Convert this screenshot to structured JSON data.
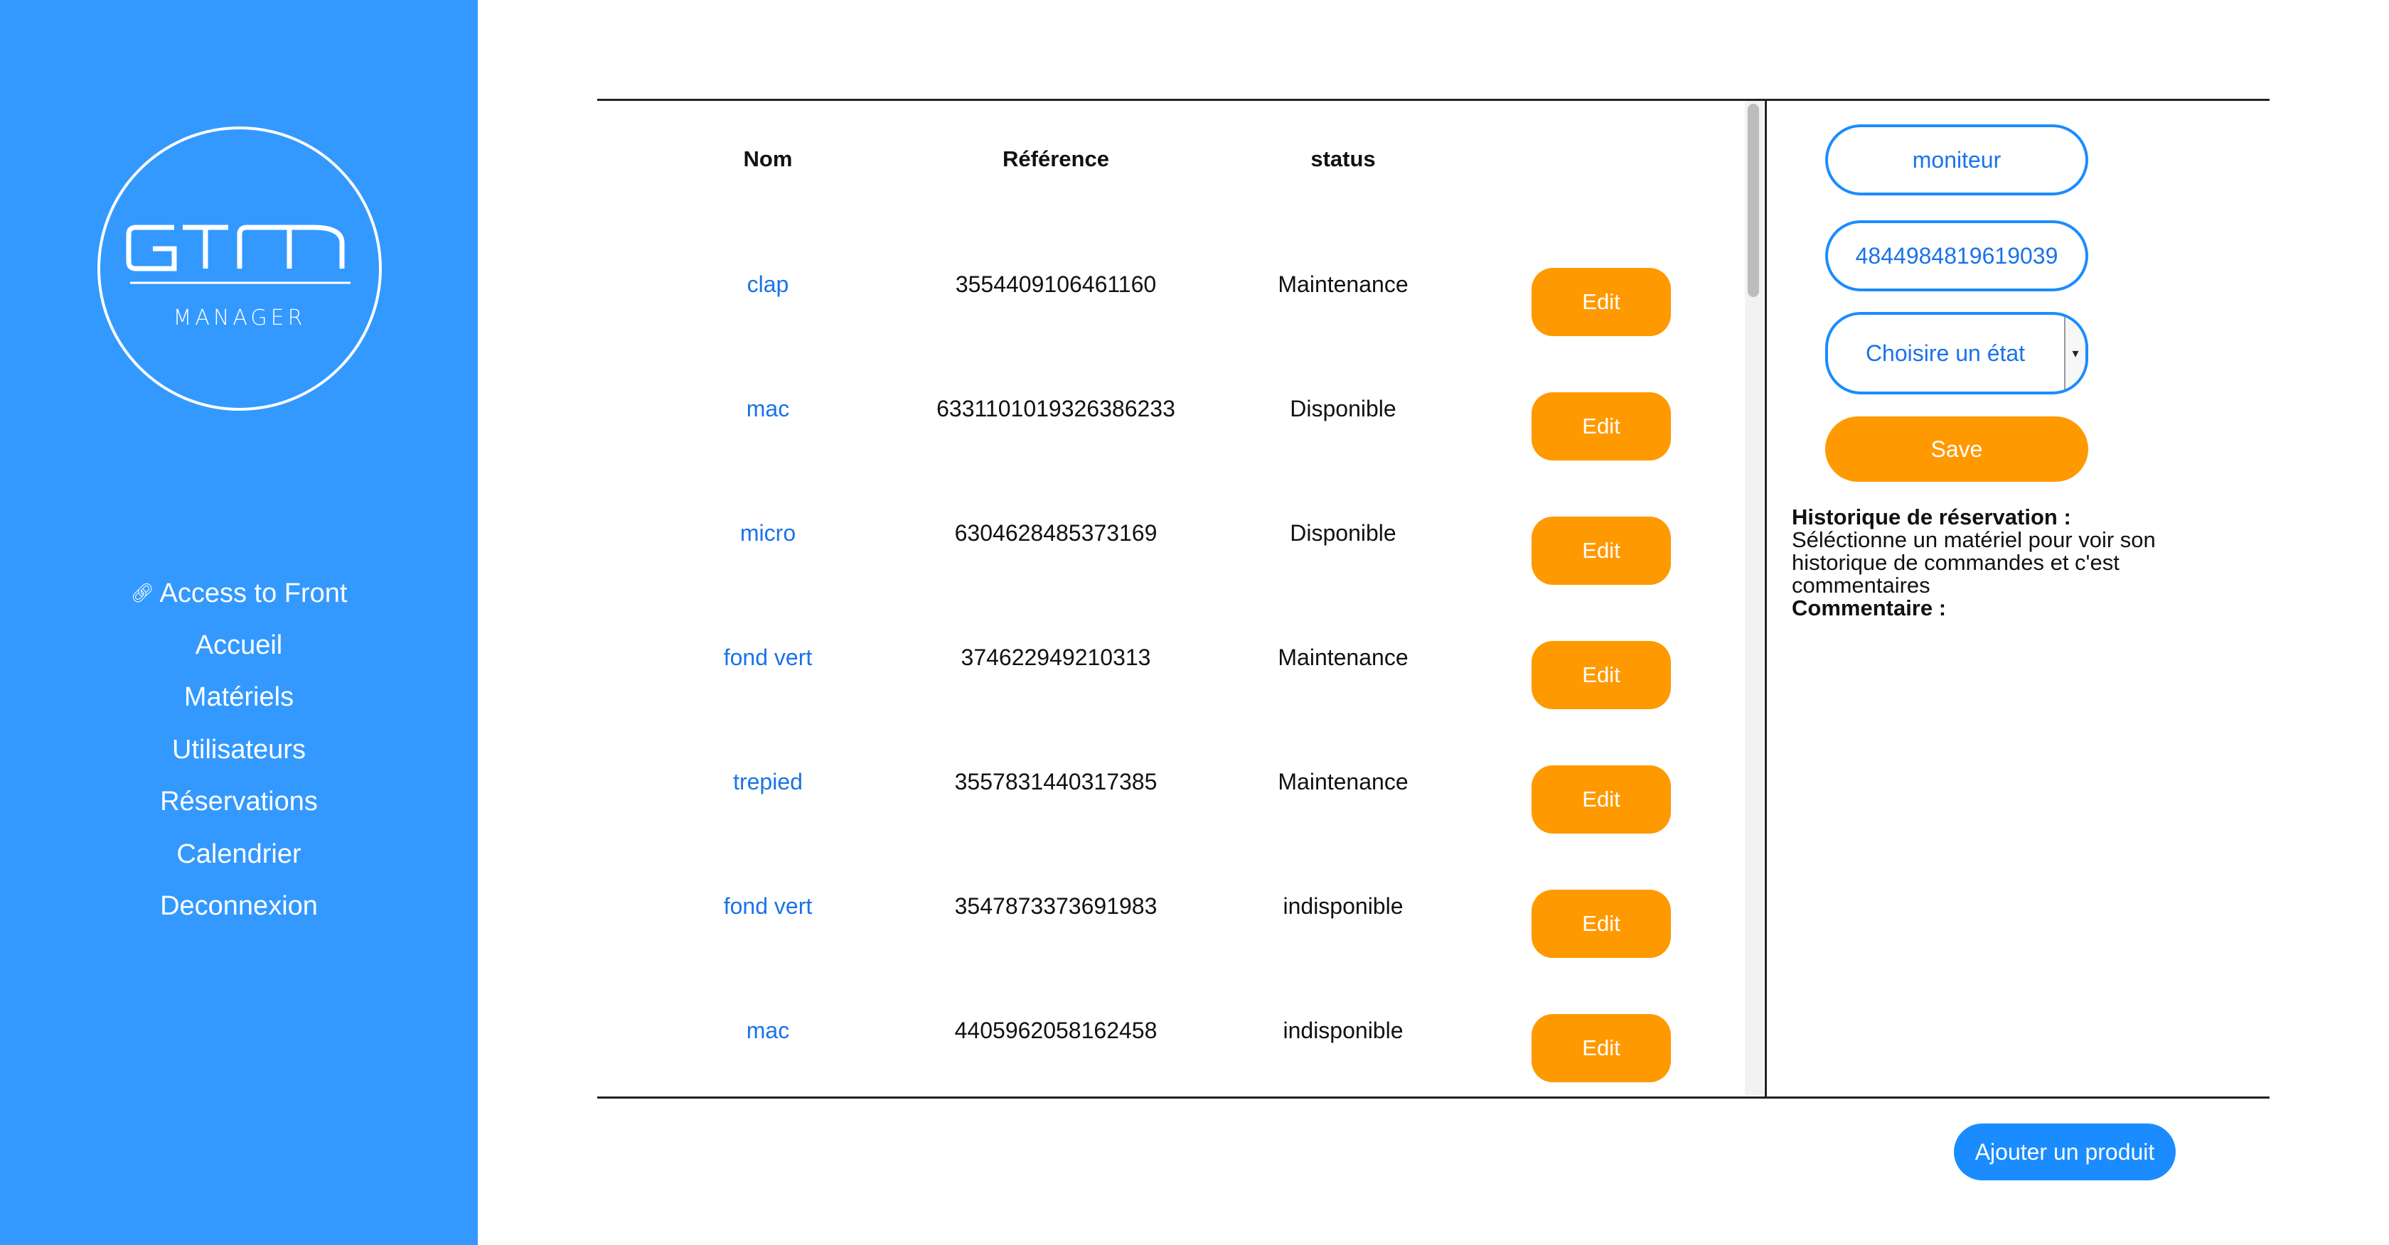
{
  "brand": {
    "logo_main": "GTM",
    "logo_sub": "MANAGER"
  },
  "sidebar": {
    "items": [
      {
        "label": "Access to Front",
        "icon": "link-icon"
      },
      {
        "label": "Accueil"
      },
      {
        "label": "Matériels"
      },
      {
        "label": "Utilisateurs"
      },
      {
        "label": "Réservations"
      },
      {
        "label": "Calendrier"
      },
      {
        "label": "Deconnexion"
      }
    ]
  },
  "table": {
    "headers": {
      "nom": "Nom",
      "reference": "Référence",
      "status": "status"
    },
    "edit_label": "Edit",
    "rows": [
      {
        "nom": "clap",
        "reference": "3554409106461160",
        "status": "Maintenance"
      },
      {
        "nom": "mac",
        "reference": "6331101019326386233",
        "status": "Disponible"
      },
      {
        "nom": "micro",
        "reference": "6304628485373169",
        "status": "Disponible"
      },
      {
        "nom": "fond vert",
        "reference": "374622949210313",
        "status": "Maintenance"
      },
      {
        "nom": "trepied",
        "reference": "3557831440317385",
        "status": "Maintenance"
      },
      {
        "nom": "fond vert",
        "reference": "3547873373691983",
        "status": "indisponible"
      },
      {
        "nom": "mac",
        "reference": "4405962058162458",
        "status": "indisponible"
      }
    ]
  },
  "detail": {
    "name_value": "moniteur",
    "reference_value": "4844984819619039",
    "state_select": "Choisire un état",
    "save_label": "Save",
    "history_title": "Historique de réservation :",
    "history_text": "Séléctionne un matériel pour voir son historique de commandes et c'est commentaires",
    "comment_title": "Commentaire :"
  },
  "actions": {
    "add_product_label": "Ajouter un produit"
  },
  "colors": {
    "sidebar_bg": "#3399ff",
    "accent_orange": "#ff9900",
    "accent_blue": "#1a8cff",
    "link_blue": "#1a73e8"
  }
}
